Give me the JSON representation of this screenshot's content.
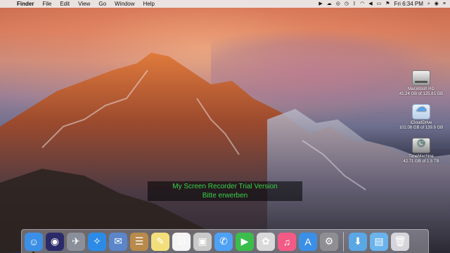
{
  "menubar": {
    "apple_glyph": "",
    "items": [
      "Finder",
      "File",
      "Edit",
      "View",
      "Go",
      "Window",
      "Help"
    ],
    "clock": "Fri 6:34 PM",
    "status_icons": [
      "screen-recorder-icon",
      "upload-icon",
      "creative-cloud-icon",
      "time-machine-icon",
      "bluetooth-icon",
      "wifi-icon",
      "volume-icon",
      "battery-icon",
      "flag-icon"
    ]
  },
  "desktop": {
    "icons": [
      {
        "name": "Macintosh HD",
        "caption": "41.24 GB of 125.81 GB"
      },
      {
        "name": "iCloudDrive",
        "caption": "102.08 GB of 139.9 GB"
      },
      {
        "name": "TimeMachine",
        "caption": "42.71 GB of 1.5 TB"
      }
    ]
  },
  "watermark": {
    "line1": "My Screen Recorder Trial Version",
    "line2": "Bitte erwerben"
  },
  "dock": {
    "apps": [
      {
        "icon": "finder-icon",
        "color": "#3b8fe6"
      },
      {
        "icon": "siri-icon",
        "color": "#2b2b6a"
      },
      {
        "icon": "launchpad-icon",
        "color": "#8a8f99"
      },
      {
        "icon": "safari-icon",
        "color": "#2d8be8"
      },
      {
        "icon": "mail-stamp-icon",
        "color": "#5b86c9"
      },
      {
        "icon": "contacts-icon",
        "color": "#b88a4c"
      },
      {
        "icon": "notes-icon",
        "color": "#f2df7b"
      },
      {
        "icon": "reminders-icon",
        "color": "#f4f4f4"
      },
      {
        "icon": "preview-icon",
        "color": "#c9c9c9"
      },
      {
        "icon": "messages-icon",
        "color": "#4ea1f5"
      },
      {
        "icon": "facetime-icon",
        "color": "#3bbd4c"
      },
      {
        "icon": "photos-icon",
        "color": "#d9d9d9"
      },
      {
        "icon": "itunes-icon",
        "color": "#f35b86"
      },
      {
        "icon": "app-store-icon",
        "color": "#3b8fe6"
      },
      {
        "icon": "system-preferences-icon",
        "color": "#8e8e93"
      }
    ],
    "folders": [
      {
        "icon": "downloads-folder-icon",
        "color": "#5aa7e6"
      },
      {
        "icon": "documents-folder-icon",
        "color": "#6bb3ec"
      }
    ],
    "trash_icon": "trash-icon"
  }
}
